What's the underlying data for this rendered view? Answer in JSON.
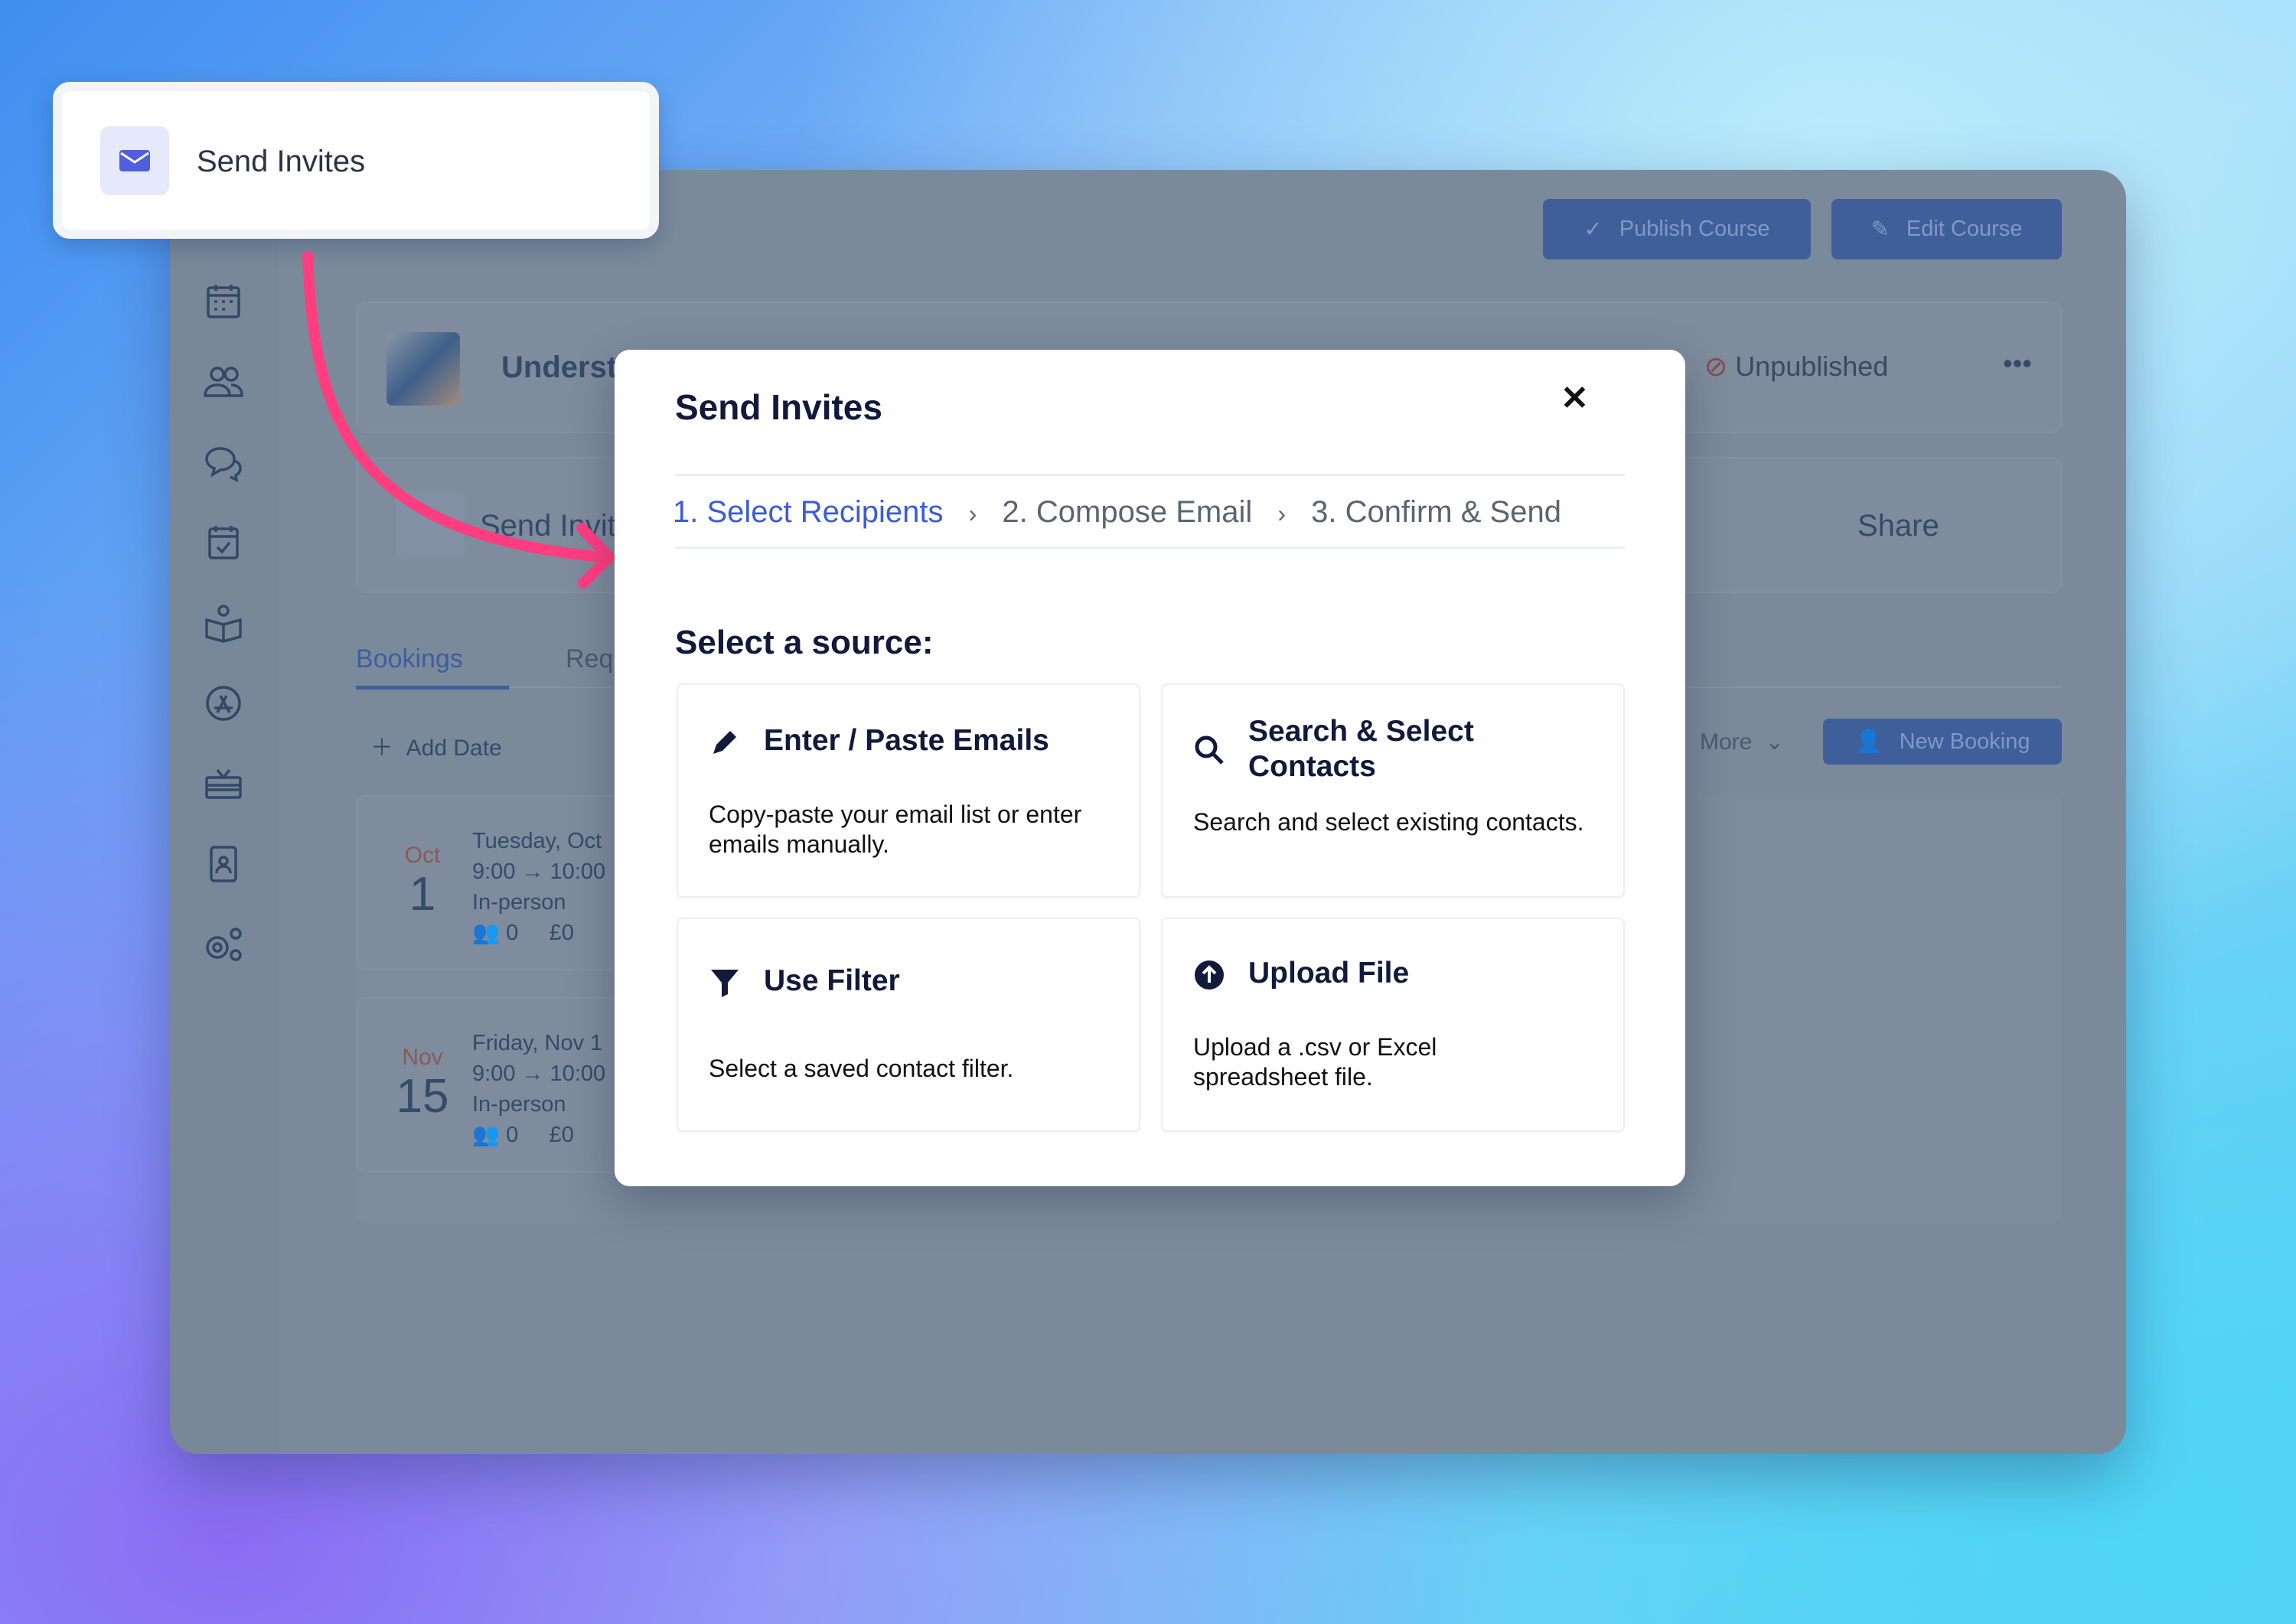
{
  "popup": {
    "label": "Send Invites",
    "icon": "envelope-icon"
  },
  "header": {
    "publish_label": "Publish Course",
    "edit_label": "Edit Course"
  },
  "course": {
    "title_partial": "Underst",
    "status": "Unpublished",
    "more": "•••"
  },
  "actions": {
    "send_invites_partial": "Send Invit",
    "share_partial": "Share"
  },
  "tabs": [
    {
      "label": "Bookings",
      "active": true
    },
    {
      "label": "Req"
    }
  ],
  "toolbar": {
    "add_date": "Add Date",
    "more": "More",
    "new_booking": "New Booking"
  },
  "bookings": [
    {
      "month": "Oct",
      "day": "1",
      "date_partial": "Tuesday, Oct",
      "time_partial": "9:00 → 10:00",
      "mode": "In-person",
      "attendees": "0",
      "price": "£0"
    },
    {
      "month": "Nov",
      "day": "15",
      "date_partial": "Friday, Nov 1",
      "time_partial": "9:00 → 10:00",
      "mode": "In-person",
      "attendees": "0",
      "price": "£0"
    }
  ],
  "modal": {
    "title": "Send Invites",
    "close": "✕",
    "steps": [
      {
        "label": "1. Select Recipients",
        "active": true
      },
      {
        "label": "2. Compose Email"
      },
      {
        "label": "3. Confirm & Send"
      }
    ],
    "step_separator": "›",
    "section_title": "Select a source:",
    "options": [
      {
        "title": "Enter / Paste Emails",
        "desc": "Copy-paste your email list or enter emails manually.",
        "icon": "pencil-icon"
      },
      {
        "title": "Search & Select Contacts",
        "desc": "Search and select existing contacts.",
        "icon": "search-icon"
      },
      {
        "title": "Use Filter",
        "desc": "Select a saved contact filter.",
        "icon": "filter-icon"
      },
      {
        "title": "Upload File",
        "desc": "Upload a .csv or Excel spreadsheet file.",
        "icon": "upload-icon"
      }
    ]
  },
  "colors": {
    "accent": "#3b5bdb",
    "arrow": "#ff3d7f",
    "overlay": "#7b8a9b",
    "text_dark": "#111a3b"
  }
}
